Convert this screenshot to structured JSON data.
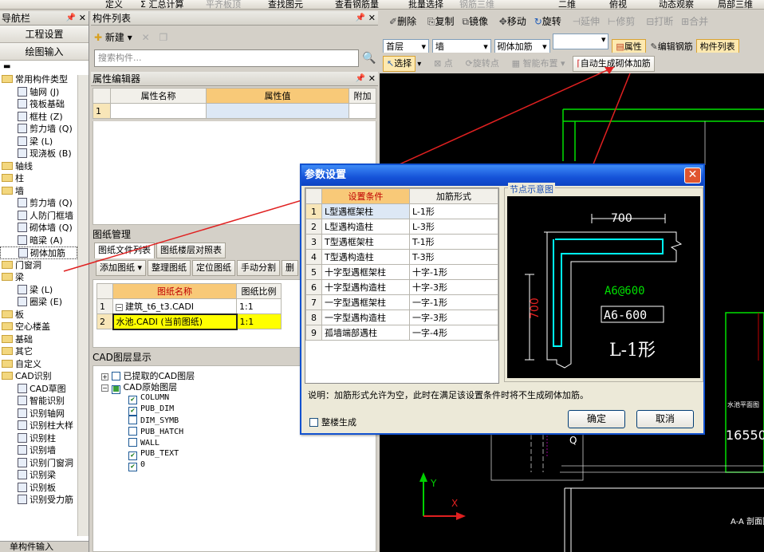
{
  "toolbar_top": [
    "定义",
    "Σ 汇总计算",
    "平齐板顶",
    "查找图元",
    "查看钢筋量",
    "批量选择",
    "钢筋三维",
    "二维",
    "俯视",
    "动态观察",
    "局部三维"
  ],
  "nav": {
    "title": "导航栏",
    "project_btn": "工程设置",
    "draw_btn": "绘图输入",
    "items": [
      {
        "label": "常用构件类型",
        "type": "folder"
      },
      {
        "label": "轴网 (J)",
        "type": "icon"
      },
      {
        "label": "筏板基础",
        "type": "icon"
      },
      {
        "label": "框柱 (Z)",
        "type": "icon"
      },
      {
        "label": "剪力墙 (Q)",
        "type": "icon"
      },
      {
        "label": "梁 (L)",
        "type": "icon"
      },
      {
        "label": "现浇板 (B)",
        "type": "icon"
      },
      {
        "label": "轴线",
        "type": "folder"
      },
      {
        "label": "柱",
        "type": "folder"
      },
      {
        "label": "墙",
        "type": "folder"
      },
      {
        "label": "剪力墙 (Q)",
        "type": "icon"
      },
      {
        "label": "人防门框墙",
        "type": "icon"
      },
      {
        "label": "砌体墙 (Q)",
        "type": "icon"
      },
      {
        "label": "暗梁 (A)",
        "type": "icon"
      },
      {
        "label": "砌体加筋",
        "type": "icon"
      },
      {
        "label": "门窗洞",
        "type": "folder"
      },
      {
        "label": "梁",
        "type": "folder"
      },
      {
        "label": "梁 (L)",
        "type": "icon"
      },
      {
        "label": "圈梁 (E)",
        "type": "icon"
      },
      {
        "label": "板",
        "type": "folder"
      },
      {
        "label": "空心楼盖",
        "type": "folder"
      },
      {
        "label": "基础",
        "type": "folder"
      },
      {
        "label": "其它",
        "type": "folder"
      },
      {
        "label": "自定义",
        "type": "folder"
      },
      {
        "label": "CAD识别",
        "type": "folder"
      },
      {
        "label": "CAD草图",
        "type": "icon"
      },
      {
        "label": "智能识别",
        "type": "icon"
      },
      {
        "label": "识别轴网",
        "type": "icon"
      },
      {
        "label": "识别柱大样",
        "type": "icon"
      },
      {
        "label": "识别柱",
        "type": "icon"
      },
      {
        "label": "识别墙",
        "type": "icon"
      },
      {
        "label": "识别门窗洞",
        "type": "icon"
      },
      {
        "label": "识别梁",
        "type": "icon"
      },
      {
        "label": "识别板",
        "type": "icon"
      },
      {
        "label": "识别受力筋",
        "type": "icon"
      }
    ],
    "bottom": "单构件输入"
  },
  "components": {
    "title": "构件列表",
    "new_btn": "新建",
    "search_placeholder": "搜索构件..."
  },
  "props": {
    "title": "属性编辑器",
    "col_name": "属性名称",
    "col_value": "属性值",
    "col_extra": "附加",
    "row1": "1"
  },
  "drawings": {
    "title": "图纸管理",
    "tab1": "图纸文件列表",
    "tab2": "图纸楼层对照表",
    "buttons": [
      "添加图纸",
      "整理图纸",
      "定位图纸",
      "手动分割",
      "删"
    ],
    "col_name": "图纸名称",
    "col_scale": "图纸比例",
    "rows": [
      {
        "no": "1",
        "name": "建筑_t6_t3.CADI",
        "scale": "1:1"
      },
      {
        "no": "2",
        "name": "水池.CADI (当前图纸)",
        "scale": "1:1"
      }
    ]
  },
  "cadlayers": {
    "title": "CAD图层显示",
    "extracted": "已提取的CAD图层",
    "original": "CAD原始图层",
    "layers": [
      {
        "name": "COLUMN",
        "checked": true
      },
      {
        "name": "PUB_DIM",
        "checked": true
      },
      {
        "name": "DIM_SYMB",
        "checked": false
      },
      {
        "name": "PUB_HATCH",
        "checked": false
      },
      {
        "name": "WALL",
        "checked": false
      },
      {
        "name": "PUB_TEXT",
        "checked": true
      },
      {
        "name": "0",
        "checked": true
      }
    ]
  },
  "right_toolbar": {
    "row1": [
      "删除",
      "复制",
      "镜像",
      "移动",
      "旋转",
      "延伸",
      "修剪",
      "打断",
      "合并"
    ],
    "floor": "首层",
    "type": "墙",
    "sub": "砌体加筋",
    "attr_btn": "属性",
    "edit_btn": "编辑钢筋",
    "list_btn": "构件列表",
    "select": "选择",
    "point": "点",
    "rotpoint": "旋转点",
    "smart": "智能布置",
    "auto_btn": "自动生成砌体加筋"
  },
  "canvas": {
    "text1": "水池平面图",
    "text2": "16550",
    "text3": "A-A  剖面图",
    "axis_y": "Y",
    "axis_x": "X"
  },
  "dialog": {
    "title": "参数设置",
    "col_cond": "设置条件",
    "col_form": "加筋形式",
    "rows": [
      {
        "no": "1",
        "cond": "L型遇框架柱",
        "form": "L-1形"
      },
      {
        "no": "2",
        "cond": "L型遇构造柱",
        "form": "L-3形"
      },
      {
        "no": "3",
        "cond": "T型遇框架柱",
        "form": "T-1形"
      },
      {
        "no": "4",
        "cond": "T型遇构造柱",
        "form": "T-3形"
      },
      {
        "no": "5",
        "cond": "十字型遇框架柱",
        "form": "十字-1形"
      },
      {
        "no": "6",
        "cond": "十字型遇构造柱",
        "form": "十字-3形"
      },
      {
        "no": "7",
        "cond": "一字型遇框架柱",
        "form": "一字-1形"
      },
      {
        "no": "8",
        "cond": "一字型遇构造柱",
        "form": "一字-3形"
      },
      {
        "no": "9",
        "cond": "孤墙端部遇柱",
        "form": "一字-4形"
      }
    ],
    "diagram_title": "节点示意图",
    "dim_h": "700",
    "dim_v": "700",
    "green_label": "A6@600",
    "box_label": "A6-600",
    "shape_label": "L-1形",
    "note": "说明：加筋形式允许为空，此时在满足该设置条件时将不生成砌体加筋。",
    "whole_floor": "整楼生成",
    "ok": "确定",
    "cancel": "取消"
  },
  "colors": {
    "accent": "#1552d8",
    "highlight_row": "#ffff00",
    "orange": "#f8c978",
    "canvas_green": "#00ff00",
    "arrow_red": "#e02020"
  }
}
